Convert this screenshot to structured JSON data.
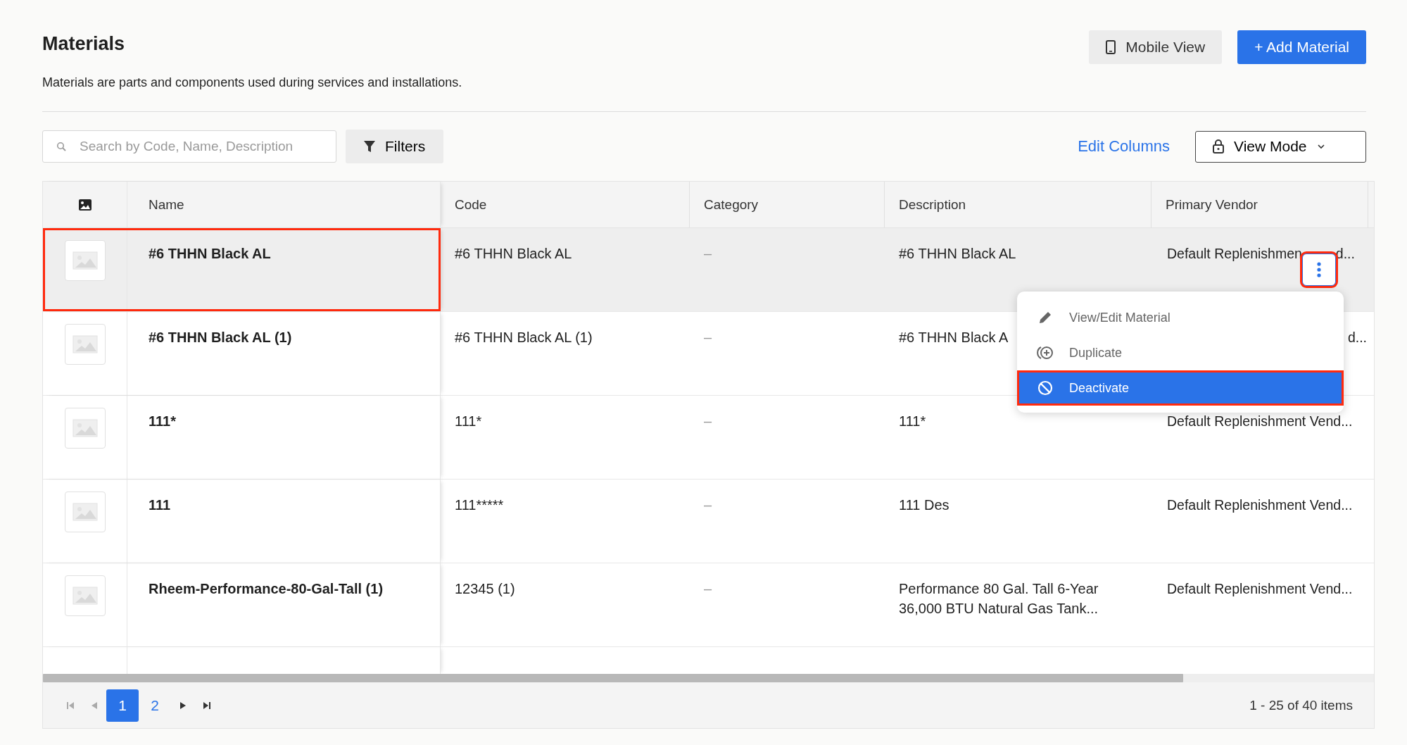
{
  "page": {
    "title": "Materials",
    "subtitle": "Materials are parts and components used during services and installations.",
    "buttons": [
      {
        "kind": "secondary",
        "label": "Mobile View"
      },
      {
        "kind": "primary",
        "label": "+ Add Material"
      }
    ]
  },
  "toolbar": {
    "search": {
      "placeholder": "Search by Code, Name, Description"
    },
    "filters": "Filters",
    "edit_columns": "Edit Columns",
    "view_mode": "View Mode"
  },
  "table": {
    "columns": [
      "Name",
      "Code",
      "Category",
      "Description",
      "Primary Vendor"
    ],
    "rows": [
      {
        "name": "#6 THHN Black AL",
        "code": "#6 THHN Black AL",
        "category": "–",
        "description": "#6 THHN Black AL",
        "vendor": "Default Replenishmen",
        "vendor_tail": "d...",
        "selected": true,
        "highlighted": true
      },
      {
        "name": "#6 THHN Black AL (1)",
        "code": "#6 THHN Black AL (1)",
        "category": "–",
        "description": "#6 THHN Black A",
        "vendor": "d...",
        "vendor_clipped": true,
        "selected": false,
        "highlighted": false
      },
      {
        "name": "111*",
        "code": "111*",
        "category": "–",
        "description": "111*",
        "vendor": "Default Replenishment Vend...",
        "selected": false,
        "highlighted": false
      },
      {
        "name": "111",
        "code": "111*****",
        "category": "–",
        "description": "111 Des",
        "vendor": "Default Replenishment Vend...",
        "selected": false,
        "highlighted": false
      },
      {
        "name": "Rheem-Performance-80-Gal-Tall (1)",
        "code": "12345 (1)",
        "category": "–",
        "description": "Performance 80 Gal. Tall 6-Year 36,000 BTU Natural Gas Tank...",
        "vendor": "Default Replenishment Vend...",
        "selected": false,
        "highlighted": false
      }
    ],
    "row_actions": {
      "highlighted": true
    },
    "menu": {
      "items": [
        {
          "kind": "edit",
          "label": "View/Edit Material",
          "selected": false,
          "highlighted": false
        },
        {
          "kind": "duplicate",
          "label": "Duplicate",
          "selected": false,
          "highlighted": false
        },
        {
          "kind": "deactivate",
          "label": "Deactivate",
          "selected": true,
          "highlighted": true
        }
      ]
    }
  },
  "pagination": {
    "pages": [
      {
        "label": "1",
        "selected": true
      },
      {
        "label": "2",
        "selected": false
      }
    ],
    "summary": "1 - 25 of 40 items"
  }
}
